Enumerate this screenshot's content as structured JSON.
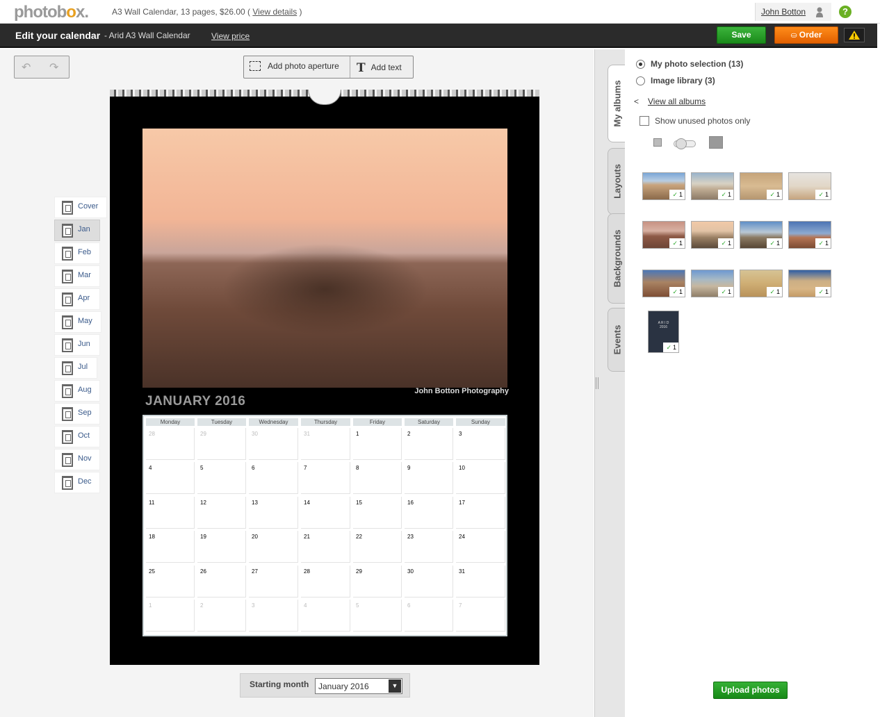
{
  "header": {
    "logo": "photobox.",
    "product": "A3 Wall Calendar,  13 pages, $26.00",
    "details_open": "( ",
    "details_link": "View details",
    "details_close": " )",
    "user": "John Botton",
    "help": "?"
  },
  "titlebar": {
    "title": "Edit your calendar",
    "subtitle": "- Arid A3 Wall Calendar",
    "view_price": "View price",
    "save": "Save",
    "order": "Order"
  },
  "tools": {
    "add_aperture": "Add photo aperture",
    "add_text": "Add text"
  },
  "pages": [
    "Cover",
    "Jan",
    "Feb",
    "Mar",
    "Apr",
    "May",
    "Jun",
    "Jul",
    "Aug",
    "Sep",
    "Oct",
    "Nov",
    "Dec"
  ],
  "selected_page": "Jan",
  "calendar": {
    "photo_credit": "John Botton Photography",
    "month_title": "JANUARY 2016",
    "weekdays": [
      "Monday",
      "Tuesday",
      "Wednesday",
      "Thursday",
      "Friday",
      "Saturday",
      "Sunday"
    ],
    "weeks": [
      [
        "28",
        "29",
        "30",
        "31",
        "1",
        "2",
        "3"
      ],
      [
        "4",
        "5",
        "6",
        "7",
        "8",
        "9",
        "10"
      ],
      [
        "11",
        "12",
        "13",
        "14",
        "15",
        "16",
        "17"
      ],
      [
        "18",
        "19",
        "20",
        "21",
        "22",
        "23",
        "24"
      ],
      [
        "25",
        "26",
        "27",
        "28",
        "29",
        "30",
        "31"
      ],
      [
        "1",
        "2",
        "3",
        "4",
        "5",
        "6",
        "7"
      ]
    ],
    "out_of_month": [
      [
        0,
        0
      ],
      [
        0,
        1
      ],
      [
        0,
        2
      ],
      [
        0,
        3
      ],
      [
        5,
        0
      ],
      [
        5,
        1
      ],
      [
        5,
        2
      ],
      [
        5,
        3
      ],
      [
        5,
        4
      ],
      [
        5,
        5
      ],
      [
        5,
        6
      ]
    ]
  },
  "starting_month": {
    "label": "Starting month",
    "value": "January 2016"
  },
  "side_tabs": [
    "My albums",
    "Layouts",
    "Backgrounds",
    "Events"
  ],
  "albums": {
    "my_selection": "My photo selection (13)",
    "image_library": "Image library (3)",
    "back": "<",
    "view_all": "View all albums",
    "unused_only": "Show unused photos only",
    "thumb_use_count": "1",
    "upload": "Upload photos",
    "cover_thumb_text": "A R I D\n2016"
  },
  "colors": {
    "save": "#2a9e2a",
    "order": "#f07010",
    "help": "#6ab023",
    "check": "#2eaa2e"
  }
}
